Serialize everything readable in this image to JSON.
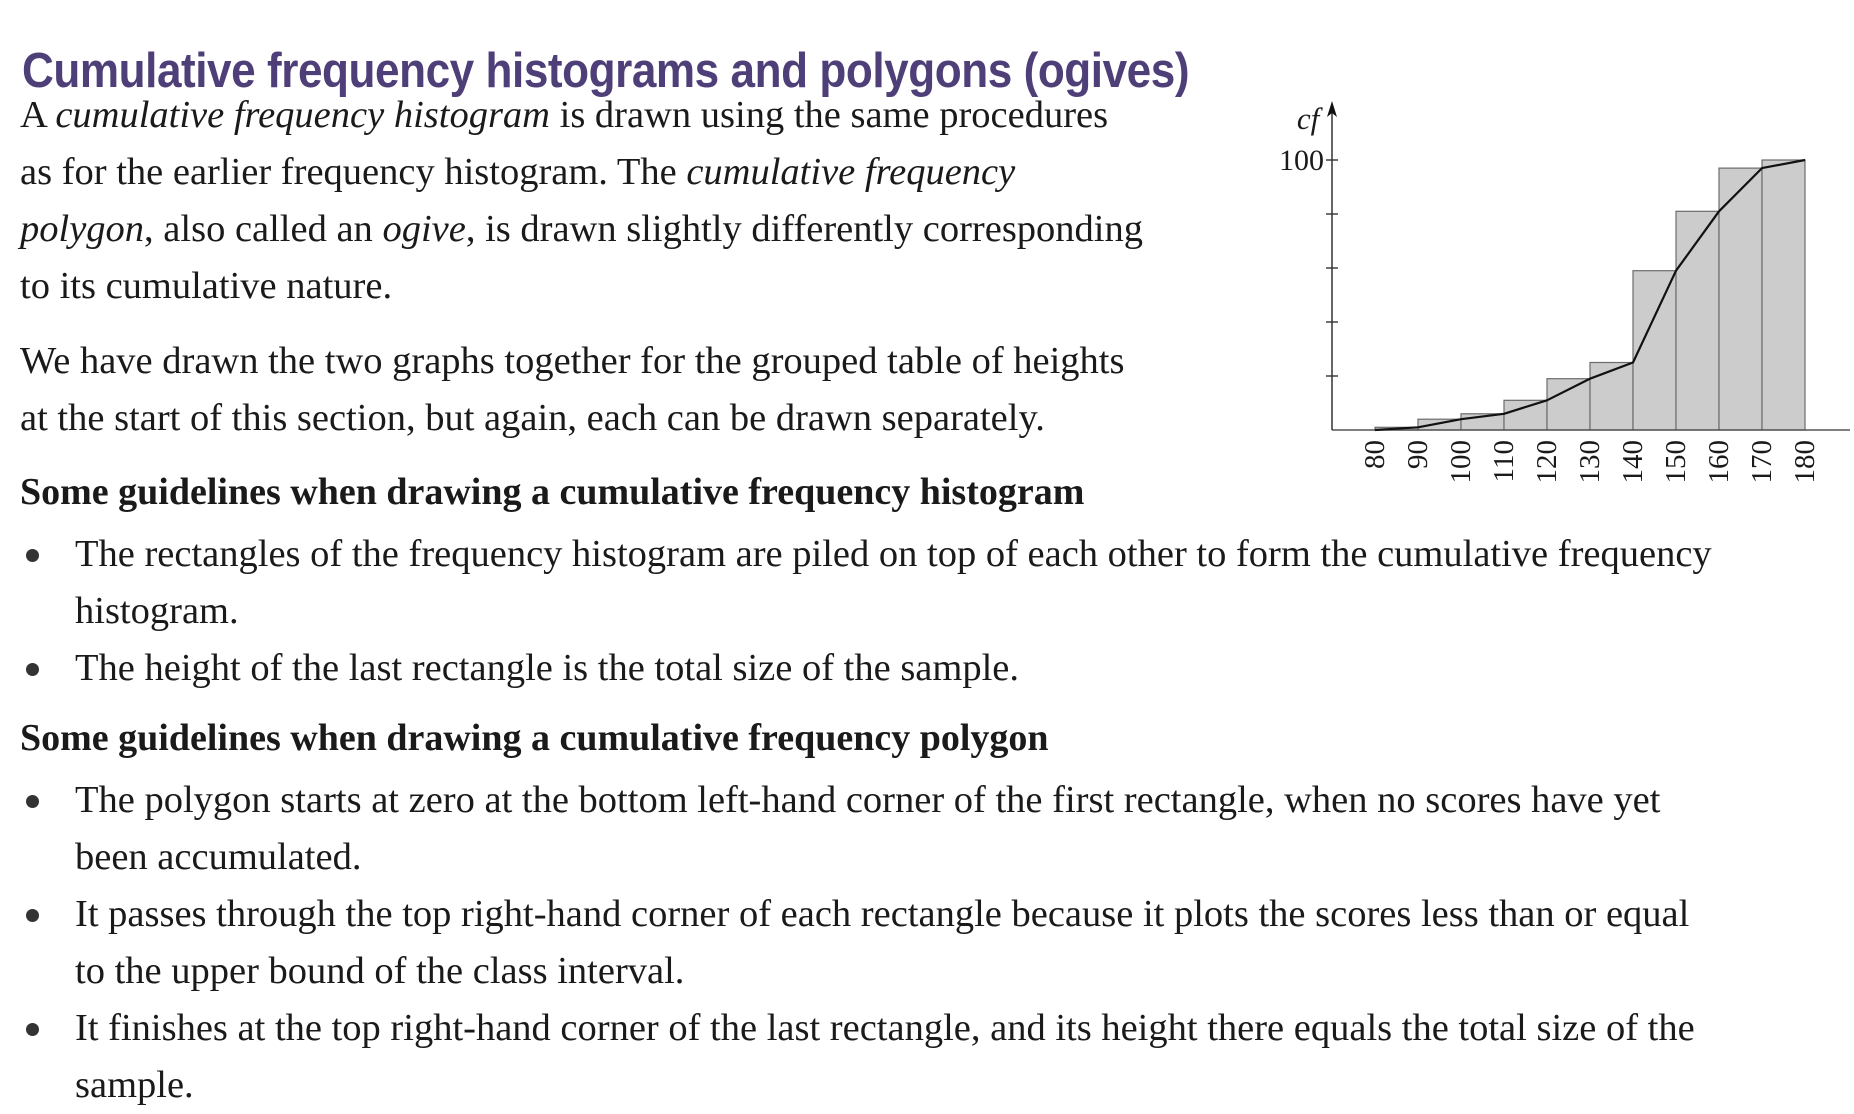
{
  "section_title": "Cumulative frequency histograms and polygons (ogives)",
  "intro": {
    "line1_a": "A ",
    "line1_b": "cumulative frequency histogram",
    "line1_c": " is drawn using the same procedures",
    "line2_a": "as for the earlier frequency histogram. The ",
    "line2_b": "cumulative frequency",
    "line3_a": "polygon",
    "line3_b": ", also called an ",
    "line3_c": "ogive",
    "line3_d": ", is drawn slightly differently corresponding",
    "line4": "to its cumulative nature."
  },
  "second_paragraph": {
    "line1": "We have drawn the two graphs together for the grouped table of heights",
    "line2": "at the start of this section, but again, each can be drawn separately."
  },
  "histogram_guidelines": {
    "heading": "Some guidelines when drawing a cumulative frequency histogram",
    "items": [
      {
        "line1": "The rectangles of the frequency histogram are piled on top of each other to form the cumulative frequency",
        "line2": "histogram."
      },
      {
        "line1": "The height of the last rectangle is the total size of the sample."
      }
    ]
  },
  "polygon_guidelines": {
    "heading": "Some guidelines when drawing a cumulative frequency polygon",
    "items": [
      {
        "line1": "The polygon starts at zero at the bottom left-hand corner of the first rectangle, when no scores have yet",
        "line2": "been accumulated."
      },
      {
        "line1": "It passes through the top right-hand corner of each rectangle because it plots the scores less than or equal",
        "line2": "to the upper bound of the class interval."
      },
      {
        "line1": "It finishes at the top right-hand corner of the last rectangle, and its height there equals the total size of the",
        "line2": "sample."
      }
    ]
  },
  "chart_data": {
    "type": "bar",
    "subtype": "cumulative frequency histogram with ogive",
    "ylabel": "cf",
    "ytick_labels": [
      "100"
    ],
    "ylim": [
      0,
      100
    ],
    "yticks": [
      20,
      40,
      60,
      80,
      100
    ],
    "class_bounds": [
      80,
      90,
      100,
      110,
      120,
      130,
      140,
      150,
      160,
      170,
      180
    ],
    "xtick_labels": [
      "80",
      "90",
      "100",
      "110",
      "120",
      "130",
      "140",
      "150",
      "160",
      "170",
      "180"
    ],
    "bars": [
      {
        "from": 80,
        "to": 90,
        "cf": 1
      },
      {
        "from": 90,
        "to": 100,
        "cf": 4
      },
      {
        "from": 100,
        "to": 110,
        "cf": 6
      },
      {
        "from": 110,
        "to": 120,
        "cf": 11
      },
      {
        "from": 120,
        "to": 130,
        "cf": 19
      },
      {
        "from": 130,
        "to": 140,
        "cf": 25
      },
      {
        "from": 140,
        "to": 150,
        "cf": 59
      },
      {
        "from": 150,
        "to": 160,
        "cf": 81
      },
      {
        "from": 160,
        "to": 170,
        "cf": 97
      },
      {
        "from": 170,
        "to": 180,
        "cf": 100
      }
    ],
    "ogive": [
      [
        80,
        0
      ],
      [
        90,
        1
      ],
      [
        100,
        4
      ],
      [
        110,
        6
      ],
      [
        120,
        11
      ],
      [
        130,
        19
      ],
      [
        140,
        25
      ],
      [
        150,
        59
      ],
      [
        160,
        81
      ],
      [
        170,
        97
      ],
      [
        180,
        100
      ]
    ],
    "bar_color": "#cccccc",
    "grid": false
  }
}
